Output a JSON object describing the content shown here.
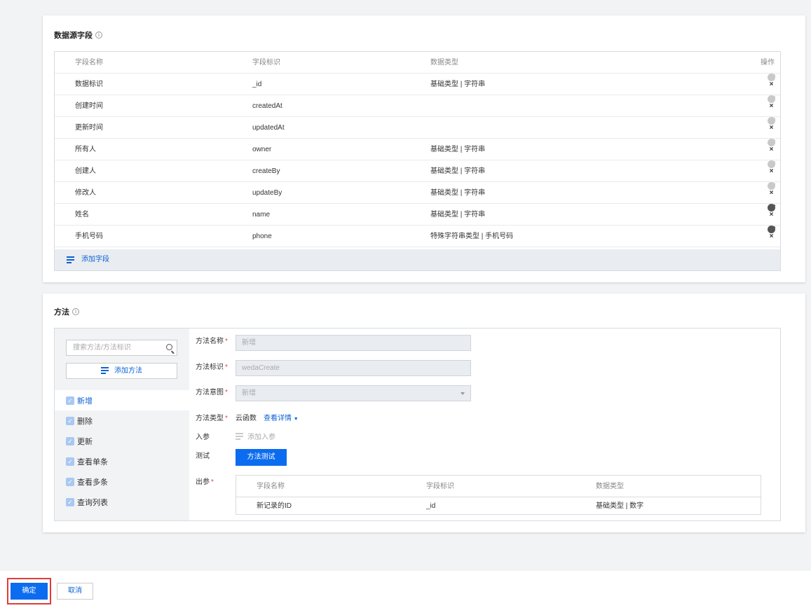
{
  "fields_section": {
    "title": "数据源字段",
    "headers": {
      "name": "字段名称",
      "id": "字段标识",
      "type": "数据类型",
      "ops": "操作"
    },
    "rows": [
      {
        "name": "数据标识",
        "id": "_id",
        "type": "基础类型 | 字符串",
        "editable": false
      },
      {
        "name": "创建时间",
        "id": "createdAt",
        "type": "",
        "editable": false
      },
      {
        "name": "更新时间",
        "id": "updatedAt",
        "type": "",
        "editable": false
      },
      {
        "name": "所有人",
        "id": "owner",
        "type": "基础类型 | 字符串",
        "editable": false
      },
      {
        "name": "创建人",
        "id": "createBy",
        "type": "基础类型 | 字符串",
        "editable": false
      },
      {
        "name": "修改人",
        "id": "updateBy",
        "type": "基础类型 | 字符串",
        "editable": false
      },
      {
        "name": "姓名",
        "id": "name",
        "type": "基础类型 | 字符串",
        "editable": true
      },
      {
        "name": "手机号码",
        "id": "phone",
        "type": "特殊字符串类型 | 手机号码",
        "editable": true
      }
    ],
    "add_field_label": "添加字段"
  },
  "methods_section": {
    "title": "方法",
    "search_placeholder": "搜索方法/方法标识",
    "add_method_label": "添加方法",
    "methods": [
      "新增",
      "删除",
      "更新",
      "查看单条",
      "查看多条",
      "查询列表"
    ],
    "active_method_index": 0,
    "form": {
      "name_label": "方法名称",
      "name_value": "新增",
      "id_label": "方法标识",
      "id_value": "wedaCreate",
      "intent_label": "方法意图",
      "intent_value": "新增",
      "type_label": "方法类型",
      "type_value": "云函数",
      "view_detail_label": "查看详情",
      "params_label": "入参",
      "add_param_label": "添加入参",
      "test_label": "测试",
      "test_button_label": "方法测试",
      "output_label": "出参",
      "output_headers": {
        "name": "字段名称",
        "id": "字段标识",
        "type": "数据类型"
      },
      "output_rows": [
        {
          "name": "新记录的ID",
          "id": "_id",
          "type": "基础类型 | 数字"
        }
      ]
    }
  },
  "footer": {
    "confirm_label": "确定",
    "cancel_label": "取消"
  },
  "colors": {
    "primary": "#0b6cf0",
    "link": "#0b62d5",
    "required": "#e54545",
    "highlight_border": "#e23b3b"
  }
}
